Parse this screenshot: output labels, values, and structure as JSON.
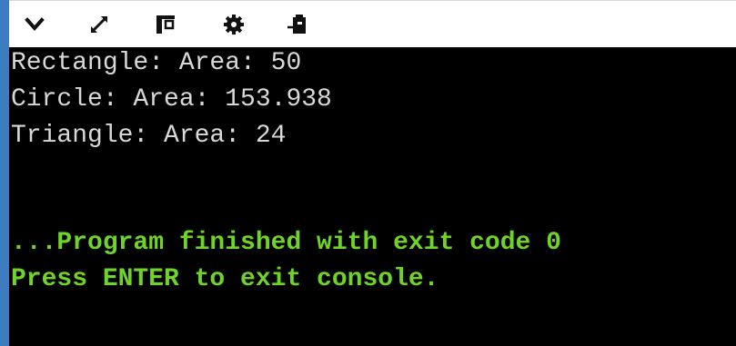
{
  "toolbar": {
    "icons": [
      "chevron-down-icon",
      "expand-icon",
      "window-icon",
      "gear-icon",
      "clipboard-icon"
    ]
  },
  "console": {
    "output_lines": [
      "Rectangle: Area: 50",
      "Circle: Area: 153.938",
      "Triangle: Area: 24"
    ],
    "finish_line": "...Program finished with exit code 0",
    "prompt_line": "Press ENTER to exit console."
  },
  "colors": {
    "console_background": "#000000",
    "output_text": "#d8d8d8",
    "status_text": "#6fd42a",
    "window_accent": "#3e7cc2"
  }
}
